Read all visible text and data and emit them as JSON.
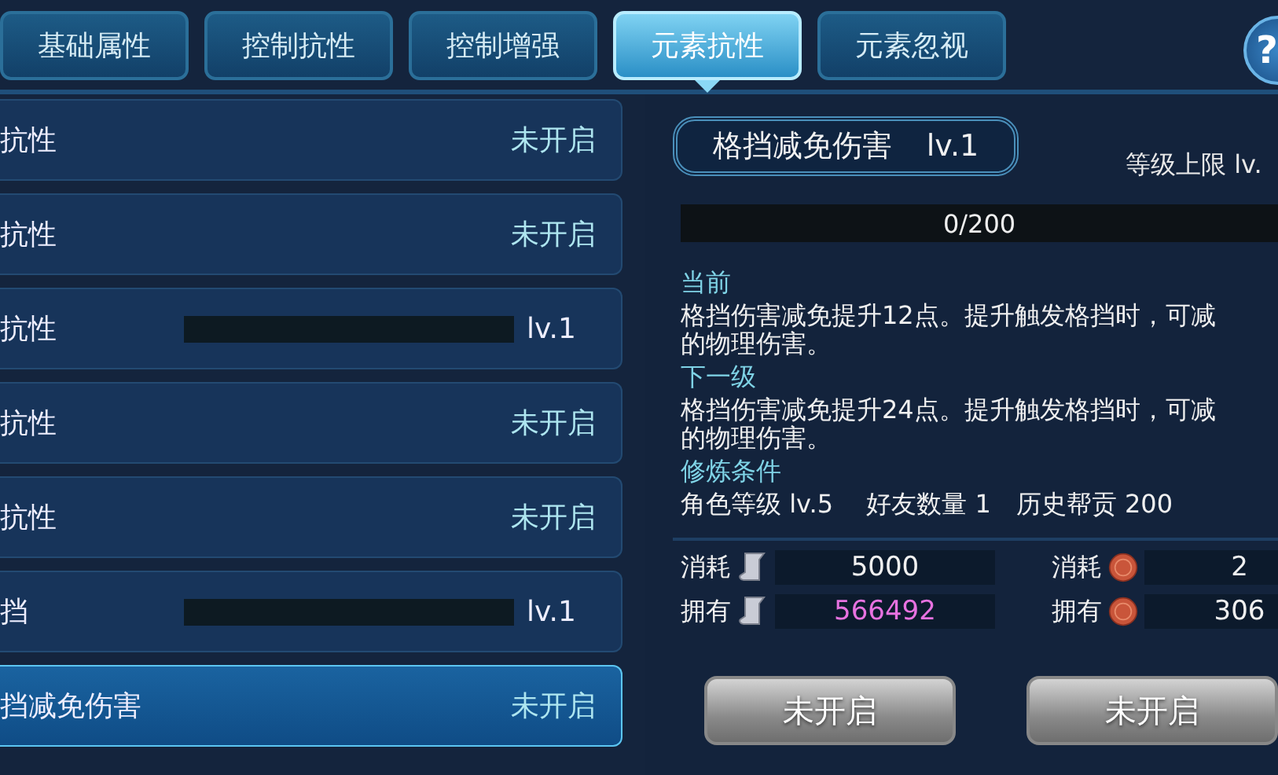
{
  "tabs": [
    {
      "label": "基础属性",
      "selected": false
    },
    {
      "label": "控制抗性",
      "selected": false
    },
    {
      "label": "控制增强",
      "selected": false
    },
    {
      "label": "元素抗性",
      "selected": true
    },
    {
      "label": "元素忽视",
      "selected": false
    }
  ],
  "help_button": {
    "label": "?"
  },
  "resist_list": [
    {
      "name": "抗性",
      "kind": "locked",
      "status": "未开启",
      "selected": false
    },
    {
      "name": "抗性",
      "kind": "locked",
      "status": "未开启",
      "selected": false
    },
    {
      "name": "抗性",
      "kind": "level",
      "level": 0,
      "status": "lv.1",
      "selected": false
    },
    {
      "name": "抗性",
      "kind": "locked",
      "status": "未开启",
      "selected": false
    },
    {
      "name": "抗性",
      "kind": "locked",
      "status": "未开启",
      "selected": false
    },
    {
      "name": "挡",
      "kind": "level",
      "level": 0,
      "status": "lv.1",
      "selected": false
    },
    {
      "name": "挡减免伤害",
      "kind": "locked",
      "status": "未开启",
      "selected": true
    }
  ],
  "detail": {
    "title": "格挡减免伤害",
    "level": "lv.1",
    "level_cap": "等级上限 lv.",
    "progress": {
      "level": 0,
      "text": "0/200"
    },
    "sections": [
      {
        "heading": "当前",
        "lines": [
          "格挡伤害减免提升12点。提升触发格挡时，可减",
          "的物理伤害。"
        ]
      },
      {
        "heading": "下一级",
        "lines": [
          "格挡伤害减免提升24点。提升触发格挡时，可减",
          "的物理伤害。"
        ]
      },
      {
        "heading": "修炼条件",
        "lines": [
          "角色等级 lv.5　 好友数量 1　历史帮贡 200"
        ]
      }
    ],
    "costs": [
      {
        "label": "消耗",
        "kind": "scroll",
        "value": "5000",
        "highlight": false
      },
      {
        "label": "消耗",
        "kind": "coin",
        "value": "2",
        "highlight": false
      },
      {
        "label": "拥有",
        "kind": "scroll",
        "value": "566492",
        "highlight": true
      },
      {
        "label": "拥有",
        "kind": "coin",
        "value": "306",
        "highlight": false
      }
    ],
    "buttons": [
      "未开启",
      "未开启"
    ]
  }
}
